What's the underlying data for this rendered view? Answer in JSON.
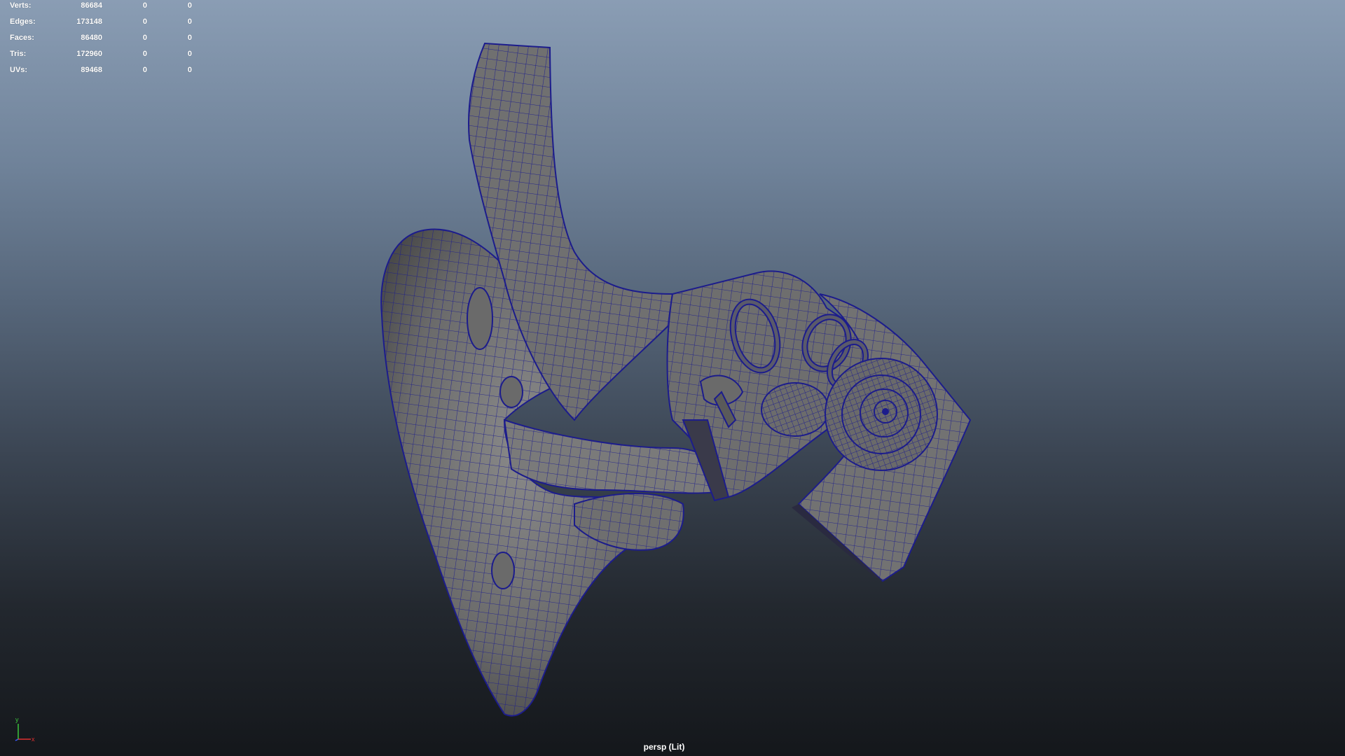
{
  "viewport": {
    "camera_label": "persp (Lit)"
  },
  "hud": {
    "rows": [
      {
        "label": "Verts:",
        "v1": "86684",
        "v2": "0",
        "v3": "0"
      },
      {
        "label": "Edges:",
        "v1": "173148",
        "v2": "0",
        "v3": "0"
      },
      {
        "label": "Faces:",
        "v1": "86480",
        "v2": "0",
        "v3": "0"
      },
      {
        "label": "Tris:",
        "v1": "172960",
        "v2": "0",
        "v3": "0"
      },
      {
        "label": "UVs:",
        "v1": "89468",
        "v2": "0",
        "v3": "0"
      }
    ]
  },
  "axis": {
    "y": "y",
    "x": "x",
    "y_color": "#3cc43c",
    "x_color": "#e03030",
    "z_color": "#3c5cff"
  },
  "colors": {
    "mesh_fill": "#707070",
    "wireframe": "#1c1c8c"
  },
  "icons": [
    "axis-gizmo-icon"
  ]
}
